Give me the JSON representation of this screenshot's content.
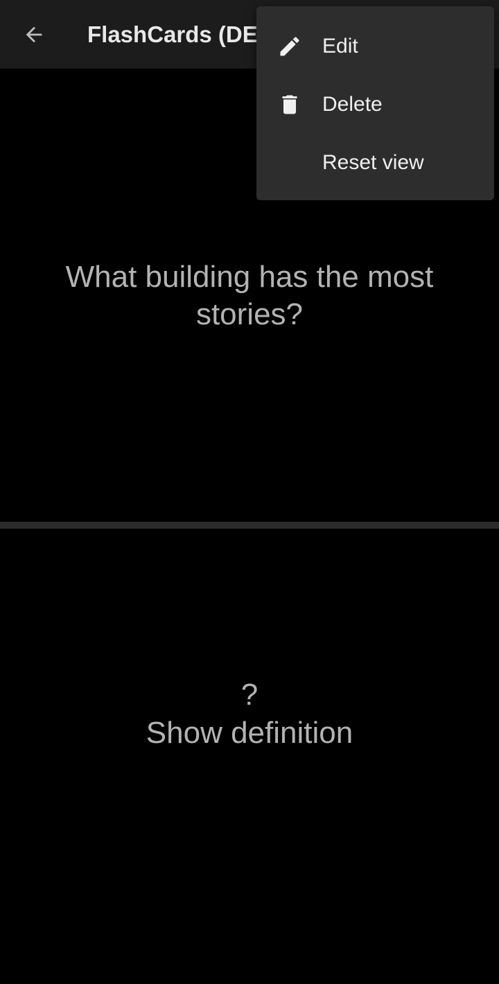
{
  "app_bar": {
    "title": "FlashCards (DEV",
    "back_icon": "arrow-back-icon"
  },
  "card": {
    "term": "What building has the most stories?",
    "reveal_mark": "?",
    "reveal_label": "Show definition"
  },
  "menu": {
    "items": [
      {
        "label": "Edit",
        "icon": "pencil-icon"
      },
      {
        "label": "Delete",
        "icon": "trash-icon"
      },
      {
        "label": "Reset view",
        "icon": ""
      }
    ]
  },
  "colors": {
    "background": "#000000",
    "app_bar": "#1c1c1c",
    "menu_background": "#2d2d2d",
    "divider": "#2b2b2b",
    "card_text": "#b3b3b3",
    "menu_text": "#f0f0f0"
  }
}
